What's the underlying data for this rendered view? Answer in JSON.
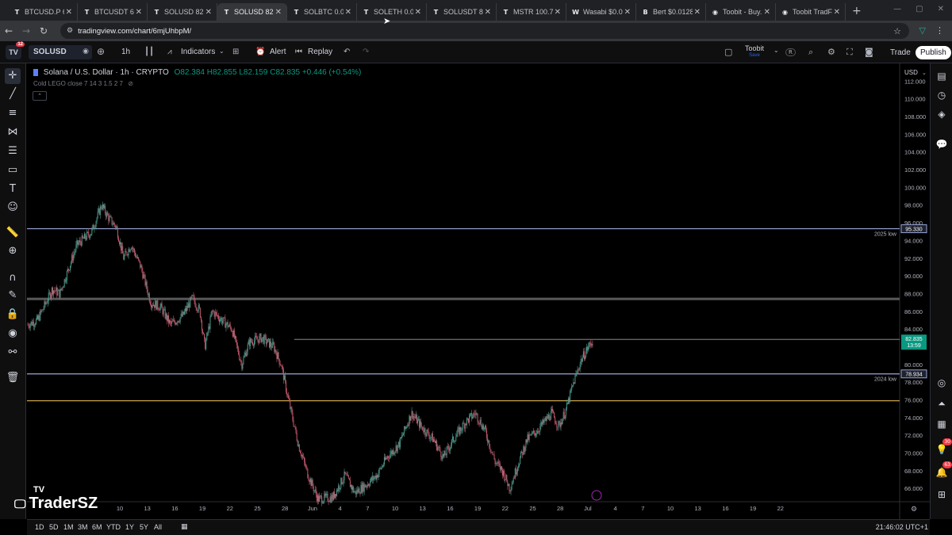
{
  "browser": {
    "tabs": [
      {
        "icon": "T",
        "label": "BTCUSD.P 62..."
      },
      {
        "icon": "T",
        "label": "BTCUSDT 62..."
      },
      {
        "icon": "T",
        "label": "SOLUSD 82.8..."
      },
      {
        "icon": "T",
        "label": "SOLUSD 82.8...",
        "active": true
      },
      {
        "icon": "T",
        "label": "SOLBTC 0.00..."
      },
      {
        "icon": "T",
        "label": "SOLETH 0.04..."
      },
      {
        "icon": "T",
        "label": "SOLUSDT 82..."
      },
      {
        "icon": "T",
        "label": "MSTR 100.7..."
      },
      {
        "icon": "W",
        "label": "Wasabi $0.00..."
      },
      {
        "icon": "B",
        "label": "Bert $0.0128..."
      },
      {
        "icon": "◉",
        "label": "Toobit - Buy..."
      },
      {
        "icon": "◉",
        "label": "Toobit TradF..."
      }
    ],
    "new_tab": "+",
    "url": "tradingview.com/chart/6mjUhbpM/"
  },
  "toolbar": {
    "logo_badge": "12",
    "symbol": "SOLUSD",
    "interval": "1h",
    "indicators": "Indicators",
    "alert": "Alert",
    "replay": "Replay",
    "broker": "Toobit",
    "broker_sub": "Save",
    "broker_r": "R",
    "trade": "Trade",
    "publish": "Publish"
  },
  "legend": {
    "title": "Solana / U.S. Dollar · 1h · CRYPTO",
    "ohlc": "O82.384 H82.855 L82.159 C82.835 +0.446 (+0.54%)",
    "indicator": "Cold LEGO close 7 14 3 1.5 2 7"
  },
  "chart_data": {
    "type": "candlestick",
    "title": "Solana / U.S. Dollar · 1h · CRYPTO",
    "currency": "USD",
    "ylim": [
      64.5,
      114.0
    ],
    "y_ticks": [
      "66.000",
      "68.000",
      "70.000",
      "72.000",
      "74.000",
      "76.000",
      "78.000",
      "80.000",
      "82.000",
      "84.000",
      "86.000",
      "88.000",
      "90.000",
      "92.000",
      "94.000",
      "96.000",
      "98.000",
      "100.000",
      "102.000",
      "104.000",
      "106.000",
      "108.000",
      "110.000",
      "112.000"
    ],
    "x_ticks": [
      "10",
      "13",
      "16",
      "19",
      "22",
      "25",
      "28",
      "Jun",
      "4",
      "7",
      "10",
      "13",
      "16",
      "19",
      "22",
      "25",
      "28",
      "Jul",
      "4",
      "7",
      "10",
      "13",
      "16",
      "19",
      "22"
    ],
    "price_path": [
      {
        "t": 0,
        "p": 84.5
      },
      {
        "t": 0.4,
        "p": 85.0
      },
      {
        "t": 1.0,
        "p": 88.5
      },
      {
        "t": 1.3,
        "p": 88.0
      },
      {
        "t": 2.0,
        "p": 93.5
      },
      {
        "t": 2.6,
        "p": 95.0
      },
      {
        "t": 3.0,
        "p": 98.0
      },
      {
        "t": 3.3,
        "p": 96.5
      },
      {
        "t": 3.6,
        "p": 95.5
      },
      {
        "t": 3.9,
        "p": 92.0
      },
      {
        "t": 4.2,
        "p": 93.5
      },
      {
        "t": 4.6,
        "p": 91.0
      },
      {
        "t": 5.0,
        "p": 87.0
      },
      {
        "t": 5.4,
        "p": 86.5
      },
      {
        "t": 5.8,
        "p": 84.5
      },
      {
        "t": 6.3,
        "p": 85.5
      },
      {
        "t": 6.7,
        "p": 87.5
      },
      {
        "t": 7.0,
        "p": 86.0
      },
      {
        "t": 7.2,
        "p": 82.0
      },
      {
        "t": 7.5,
        "p": 86.0
      },
      {
        "t": 7.9,
        "p": 85.0
      },
      {
        "t": 8.3,
        "p": 84.0
      },
      {
        "t": 8.7,
        "p": 80.0
      },
      {
        "t": 9.0,
        "p": 82.5
      },
      {
        "t": 9.5,
        "p": 83.0
      },
      {
        "t": 10.0,
        "p": 82.0
      },
      {
        "t": 10.3,
        "p": 80.0
      },
      {
        "t": 10.6,
        "p": 76.0
      },
      {
        "t": 11.0,
        "p": 71.0
      },
      {
        "t": 11.4,
        "p": 67.5
      },
      {
        "t": 11.8,
        "p": 64.8
      },
      {
        "t": 12.4,
        "p": 65.0
      },
      {
        "t": 12.9,
        "p": 67.5
      },
      {
        "t": 13.3,
        "p": 65.5
      },
      {
        "t": 13.8,
        "p": 66.5
      },
      {
        "t": 14.2,
        "p": 67.5
      },
      {
        "t": 14.6,
        "p": 69.5
      },
      {
        "t": 15.1,
        "p": 71.0
      },
      {
        "t": 15.6,
        "p": 74.5
      },
      {
        "t": 16.0,
        "p": 73.0
      },
      {
        "t": 16.5,
        "p": 71.5
      },
      {
        "t": 16.9,
        "p": 69.5
      },
      {
        "t": 17.3,
        "p": 71.5
      },
      {
        "t": 17.8,
        "p": 73.5
      },
      {
        "t": 18.2,
        "p": 74.5
      },
      {
        "t": 18.6,
        "p": 72.5
      },
      {
        "t": 19.0,
        "p": 69.0
      },
      {
        "t": 19.3,
        "p": 68.0
      },
      {
        "t": 19.6,
        "p": 66.0
      },
      {
        "t": 19.9,
        "p": 68.5
      },
      {
        "t": 20.3,
        "p": 71.5
      },
      {
        "t": 20.7,
        "p": 72.5
      },
      {
        "t": 21.0,
        "p": 73.5
      },
      {
        "t": 21.3,
        "p": 74.5
      },
      {
        "t": 21.6,
        "p": 73.0
      },
      {
        "t": 21.9,
        "p": 75.0
      },
      {
        "t": 22.2,
        "p": 78.0
      },
      {
        "t": 22.5,
        "p": 80.5
      },
      {
        "t": 22.8,
        "p": 82.0
      },
      {
        "t": 23.0,
        "p": 82.8
      }
    ],
    "levels": [
      {
        "price": 95.33,
        "label": "2025 low",
        "color": "#9aa4d6",
        "tag": "95.330"
      },
      {
        "price": 87.4,
        "label": "",
        "color": "#5a5a5a",
        "tag": ""
      },
      {
        "price": 78.934,
        "label": "2024 low",
        "color": "#9aa4d6",
        "tag": "78.934"
      },
      {
        "price": 75.9,
        "label": "",
        "color": "#c8a24a",
        "tag": ""
      }
    ],
    "current_price": {
      "price": 82.835,
      "tag": "82.835",
      "countdown": "13:59"
    }
  },
  "bottom": {
    "ranges": [
      "1D",
      "5D",
      "1M",
      "3M",
      "6M",
      "YTD",
      "1Y",
      "5Y",
      "All"
    ],
    "clock": "21:46:02 UTC+1"
  },
  "watermark": "TraderSZ",
  "widget_counts": {
    "alerts": "30",
    "notifications": "63"
  }
}
